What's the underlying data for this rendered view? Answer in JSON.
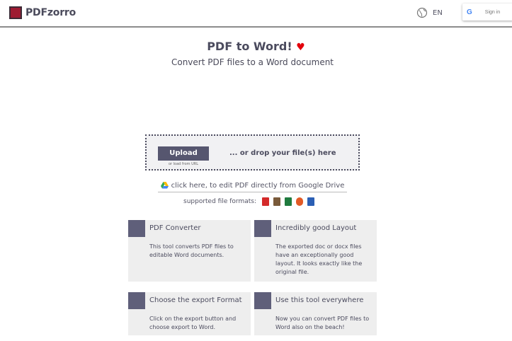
{
  "header": {
    "logo_text": "PDFzorro",
    "language": "EN",
    "signin_label": "Sign in",
    "google_letter": "G",
    "brand_color": "#9e1b32"
  },
  "hero": {
    "title": "PDF to Word!",
    "heart": "♥",
    "subtitle": "Convert PDF files to a Word document"
  },
  "upload": {
    "button_label": "Upload",
    "load_url_label": "or load from URL",
    "drop_text": "... or drop your file(s) here"
  },
  "gdrive": {
    "text": "click here, to edit PDF directly from Google Drive",
    "icon": "google-drive-icon"
  },
  "formats": {
    "label": "supported file formats:",
    "icons": [
      "pdf-icon",
      "image-icon",
      "excel-icon",
      "powerpoint-icon",
      "word-icon"
    ]
  },
  "cards": [
    {
      "title": "PDF Converter",
      "text": "This tool converts PDF files to editable Word documents."
    },
    {
      "title": "Incredibly good Layout",
      "text": "The exported doc or docx files have an exceptionally good layout. It looks exactly like the original file."
    },
    {
      "title": "Choose the export Format",
      "text": "Click on the export button and choose export to Word."
    },
    {
      "title": "Use this tool everywhere",
      "text": "Now you can convert PDF files to Word also on the beach!"
    }
  ]
}
